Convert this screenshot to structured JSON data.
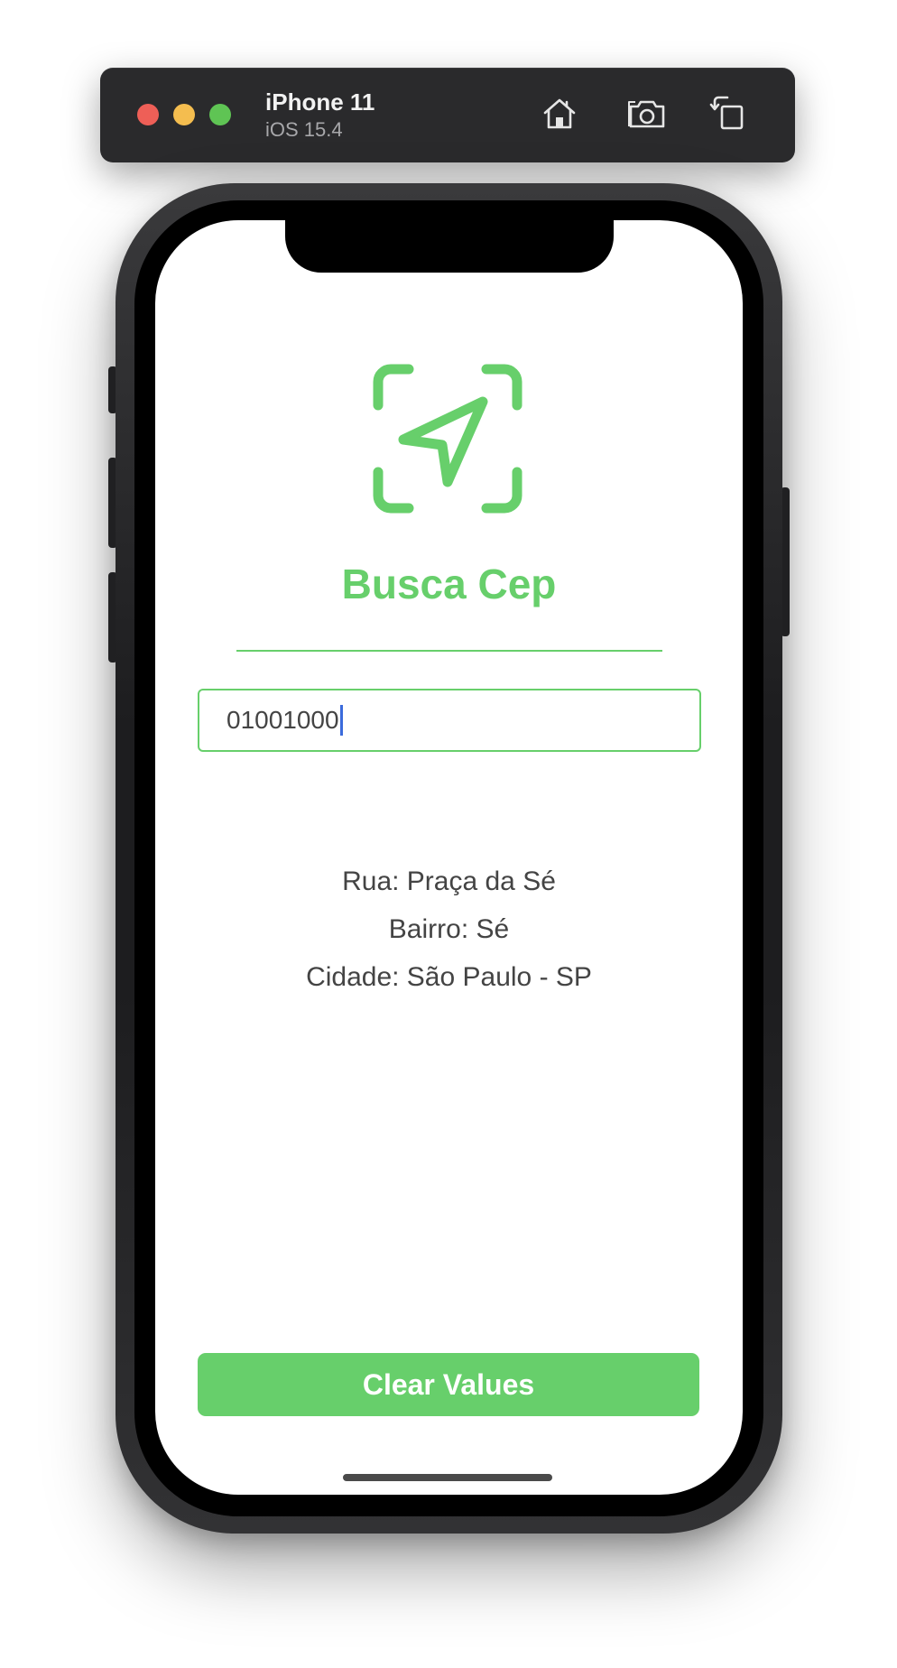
{
  "simulator": {
    "device_name": "iPhone 11",
    "os_version": "iOS 15.4",
    "icons": [
      "home-icon",
      "screenshot-camera-icon",
      "rotate-icon"
    ]
  },
  "app": {
    "title": "Busca Cep",
    "logo_icon": "location-arrow-viewfinder-icon",
    "accent_color": "#67cf6b",
    "cep_input": {
      "value": "01001000"
    },
    "results": {
      "rua": "Rua: Praça da Sé",
      "bairro": "Bairro: Sé",
      "cidade": "Cidade: São Paulo - SP"
    },
    "clear_button_label": "Clear Values"
  }
}
